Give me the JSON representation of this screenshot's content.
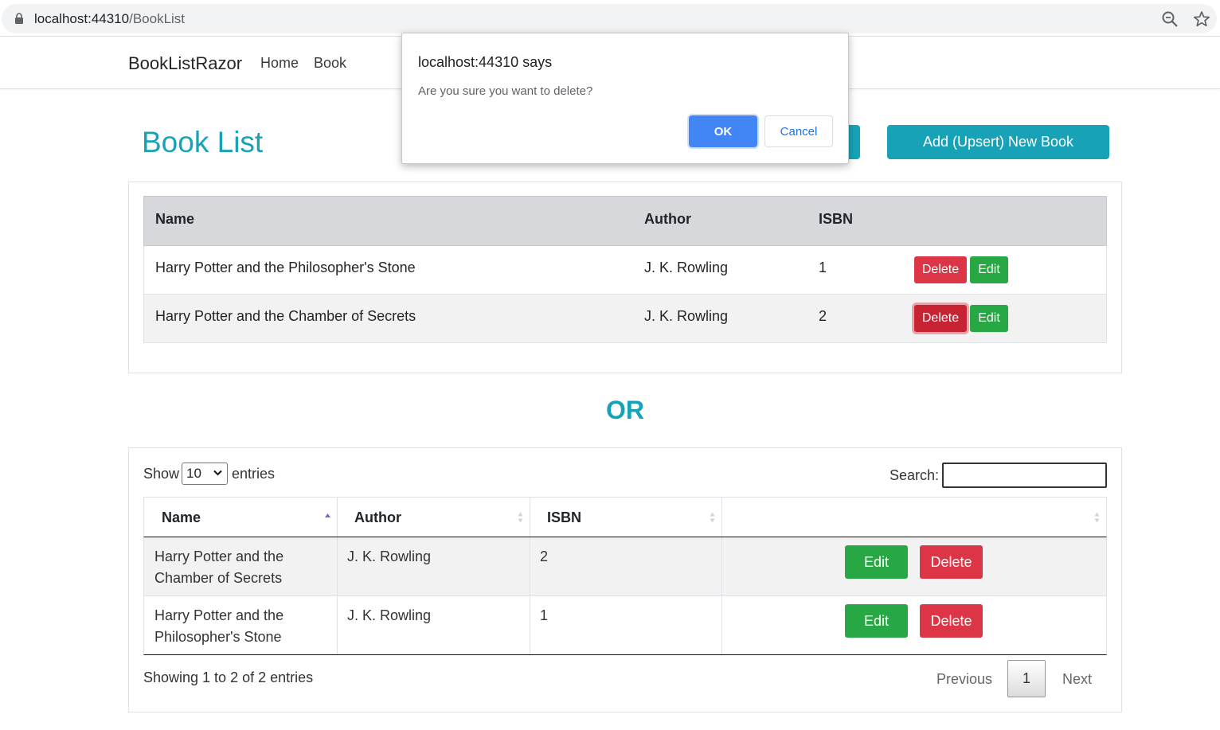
{
  "browser": {
    "url_host": "localhost:44310",
    "url_path": "/BookList",
    "icons": [
      "lock-icon",
      "zoom-icon",
      "star-icon"
    ]
  },
  "navbar": {
    "brand": "BookListRazor",
    "links": [
      "Home",
      "Book"
    ]
  },
  "page": {
    "title": "Book List",
    "add_button": "Add (Upsert) New Book"
  },
  "table1": {
    "headers": [
      "Name",
      "Author",
      "ISBN"
    ],
    "rows": [
      {
        "name": "Harry Potter and the Philosopher's Stone",
        "author": "J. K. Rowling",
        "isbn": "1",
        "delete": "Delete",
        "edit": "Edit"
      },
      {
        "name": "Harry Potter and the Chamber of Secrets",
        "author": "J. K. Rowling",
        "isbn": "2",
        "delete": "Delete",
        "edit": "Edit"
      }
    ]
  },
  "separator": "OR",
  "datatable": {
    "show_label": "Show",
    "page_length": "10",
    "entries_label": "entries",
    "search_label": "Search:",
    "search_value": "",
    "headers": [
      "Name",
      "Author",
      "ISBN",
      ""
    ],
    "rows": [
      {
        "name": "Harry Potter and the Chamber of Secrets",
        "author": "J. K. Rowling",
        "isbn": "2",
        "edit": "Edit",
        "delete": "Delete"
      },
      {
        "name": "Harry Potter and the Philosopher's Stone",
        "author": "J. K. Rowling",
        "isbn": "1",
        "edit": "Edit",
        "delete": "Delete"
      }
    ],
    "info": "Showing 1 to 2 of 2 entries",
    "pagination": {
      "previous": "Previous",
      "current": "1",
      "next": "Next"
    }
  },
  "dialog": {
    "title": "localhost:44310 says",
    "message": "Are you sure you want to delete?",
    "ok": "OK",
    "cancel": "Cancel"
  },
  "colors": {
    "primary_teal": "#17a2b8",
    "danger": "#dc3545",
    "success": "#28a745",
    "dialog_ok": "#4285f4"
  }
}
